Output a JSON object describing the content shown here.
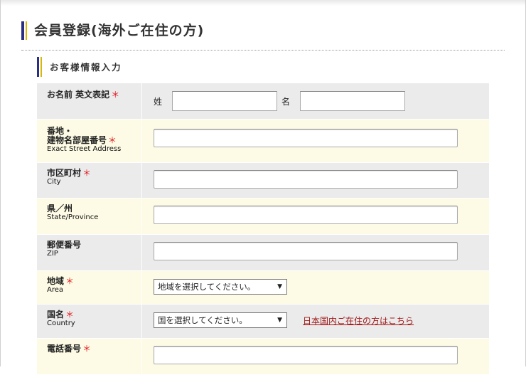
{
  "page_title": "会員登録(海外ご在住の方)",
  "section_title": "お客様情報入力",
  "required_mark": "＊",
  "fields": {
    "name": {
      "label": "お名前  英文表記",
      "last_label": "姓",
      "first_label": "名"
    },
    "street": {
      "label_line1": "番地・",
      "label_line2": "建物名部屋番号",
      "label_en": "Exact Street Address"
    },
    "city": {
      "label": "市区町村",
      "label_en": "City"
    },
    "state": {
      "label": "県／州",
      "label_en": "State/Province"
    },
    "zip": {
      "label": "郵便番号",
      "label_en": "ZIP"
    },
    "area": {
      "label": "地域",
      "label_en": "Area",
      "selected": "地域を選択してください。"
    },
    "country": {
      "label": "国名",
      "label_en": "Country",
      "selected": "国を選択してください。",
      "domestic_link": "日本国内ご在住の方はこちら"
    },
    "phone": {
      "label": "電話番号"
    }
  },
  "colors": {
    "accent_blue": "#2a2f86",
    "accent_gold": "#d8b800",
    "required_red": "#e0161b",
    "link_red": "#a21818",
    "row_gray": "#ebebeb",
    "row_cream": "#fdfbe5"
  }
}
